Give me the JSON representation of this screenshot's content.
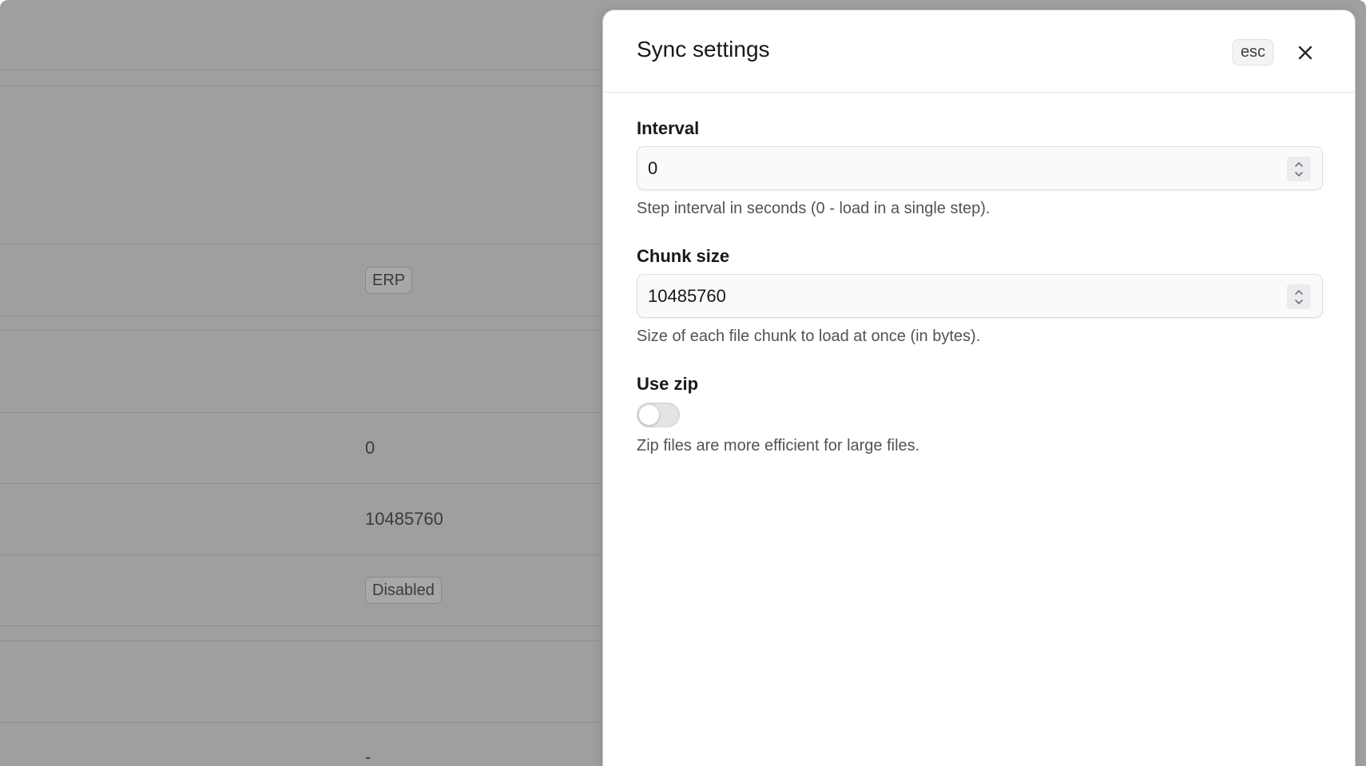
{
  "background": {
    "tag_erp": "ERP",
    "interval_value": "0",
    "chunk_value": "10485760",
    "zip_status": "Disabled",
    "trailing_value": "-"
  },
  "drawer": {
    "title": "Sync settings",
    "esc_hint": "esc",
    "close_icon": "close-icon",
    "fields": {
      "interval": {
        "label": "Interval",
        "value": "0",
        "help": "Step interval in seconds (0 - load in a single step)."
      },
      "chunk_size": {
        "label": "Chunk size",
        "value": "10485760",
        "help": "Size of each file chunk to load at once (in bytes)."
      },
      "use_zip": {
        "label": "Use zip",
        "enabled": false,
        "help": "Zip files are more efficient for large files."
      }
    }
  },
  "colors": {
    "overlay": "#9f9f9f",
    "drawer_bg": "#ffffff",
    "text_primary": "#18181b",
    "text_muted": "#52525b"
  }
}
